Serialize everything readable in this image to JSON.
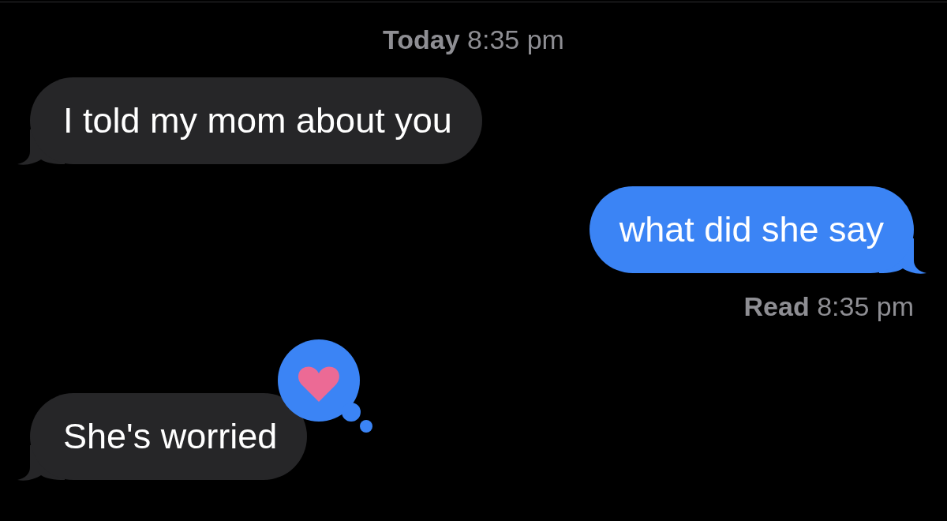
{
  "header": {
    "text": "**Today** 8:35 pm"
  },
  "messages": [
    {
      "kind": "incoming",
      "text": "I told my mom about you"
    },
    {
      "kind": "outgoing",
      "text": "what did she say",
      "receipt": "**Read** 8:35 pm"
    },
    {
      "kind": "incoming",
      "text": "She's worried",
      "tapback": {
        "kind": "heart"
      }
    }
  ]
}
